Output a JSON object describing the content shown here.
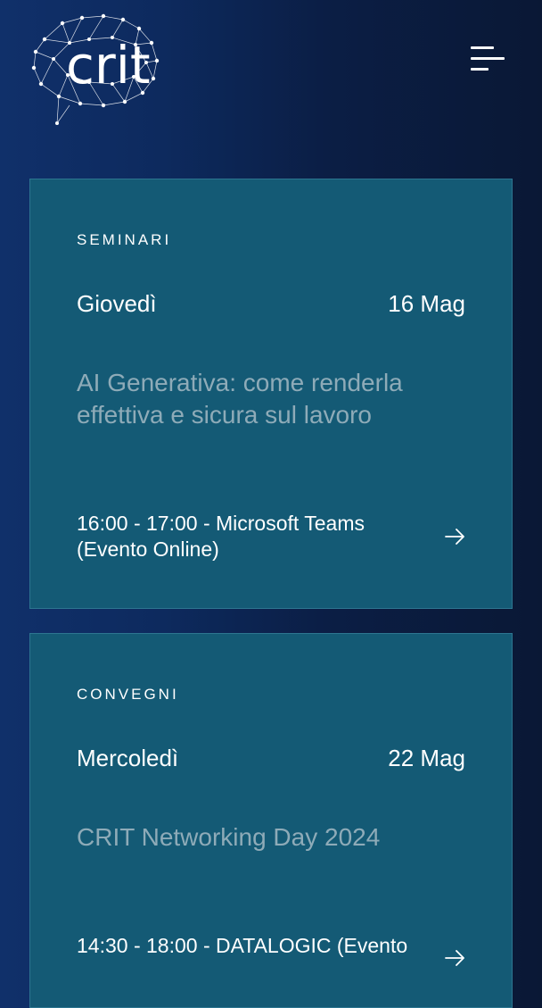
{
  "header": {
    "logo_text": "crit",
    "menu_icon": "hamburger-menu-icon"
  },
  "events": [
    {
      "category": "SEMINARI",
      "day": "Giovedì",
      "date": "16 Mag",
      "title": "AI Generativa: come renderla effettiva e sicura sul lavoro",
      "details": "16:00 - 17:00 - Microsoft Teams (Evento Online)",
      "arrow_icon": "arrow-right-icon"
    },
    {
      "category": "CONVEGNI",
      "day": "Mercoledì",
      "date": "22 Mag",
      "title": "CRIT Networking Day 2024",
      "details": "14:30 - 18:00 - DATALOGIC (Evento",
      "arrow_icon": "arrow-right-icon"
    }
  ],
  "colors": {
    "background": "#0d2a5e",
    "card": "#145a75",
    "title_text": "#8eabb8",
    "text": "#ffffff"
  }
}
